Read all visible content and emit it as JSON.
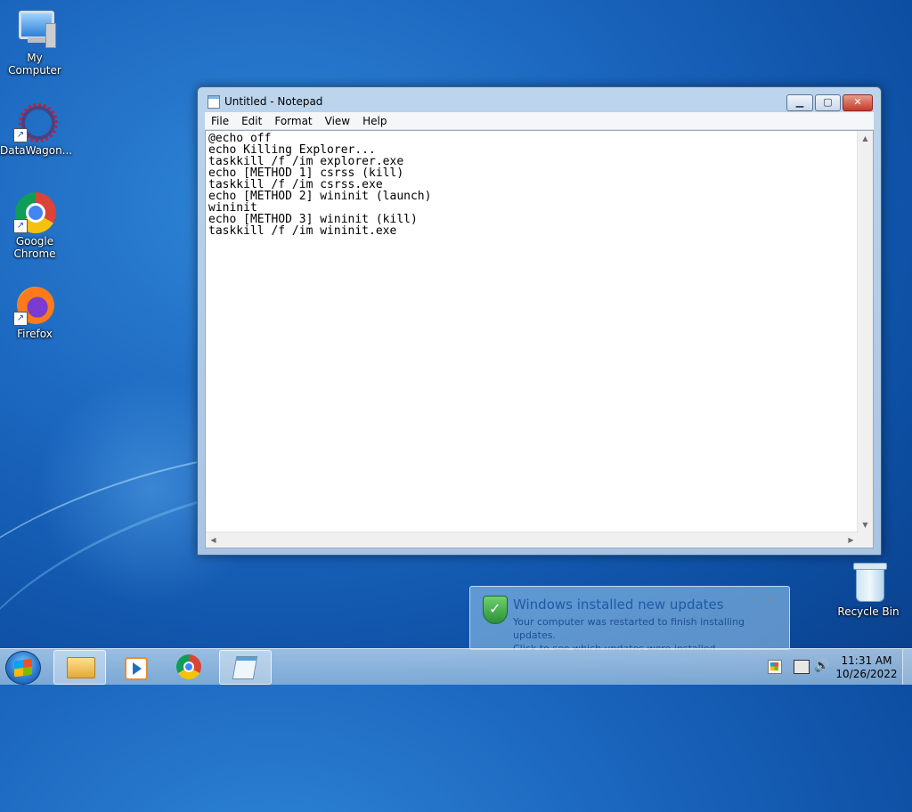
{
  "desktop": {
    "icons": [
      {
        "label": "My Computer"
      },
      {
        "label": "DataWagon..."
      },
      {
        "label": "Google\nChrome"
      },
      {
        "label": "Firefox"
      },
      {
        "label": "Recycle Bin"
      }
    ]
  },
  "notepad": {
    "title": "Untitled - Notepad",
    "menu": [
      "File",
      "Edit",
      "Format",
      "View",
      "Help"
    ],
    "content": "@echo off\necho Killing Explorer...\ntaskkill /f /im explorer.exe\necho [METHOD 1] csrss (kill)\ntaskkill /f /im csrss.exe\necho [METHOD 2] wininit (launch)\nwininit\necho [METHOD 3] wininit (kill)\ntaskkill /f /im wininit.exe"
  },
  "notification": {
    "title": "Windows installed new updates",
    "line1": "Your computer was restarted to finish installing updates.",
    "line2": "Click to see which updates were installed."
  },
  "taskbar": {
    "time": "11:31 AM",
    "date": "10/26/2022"
  }
}
